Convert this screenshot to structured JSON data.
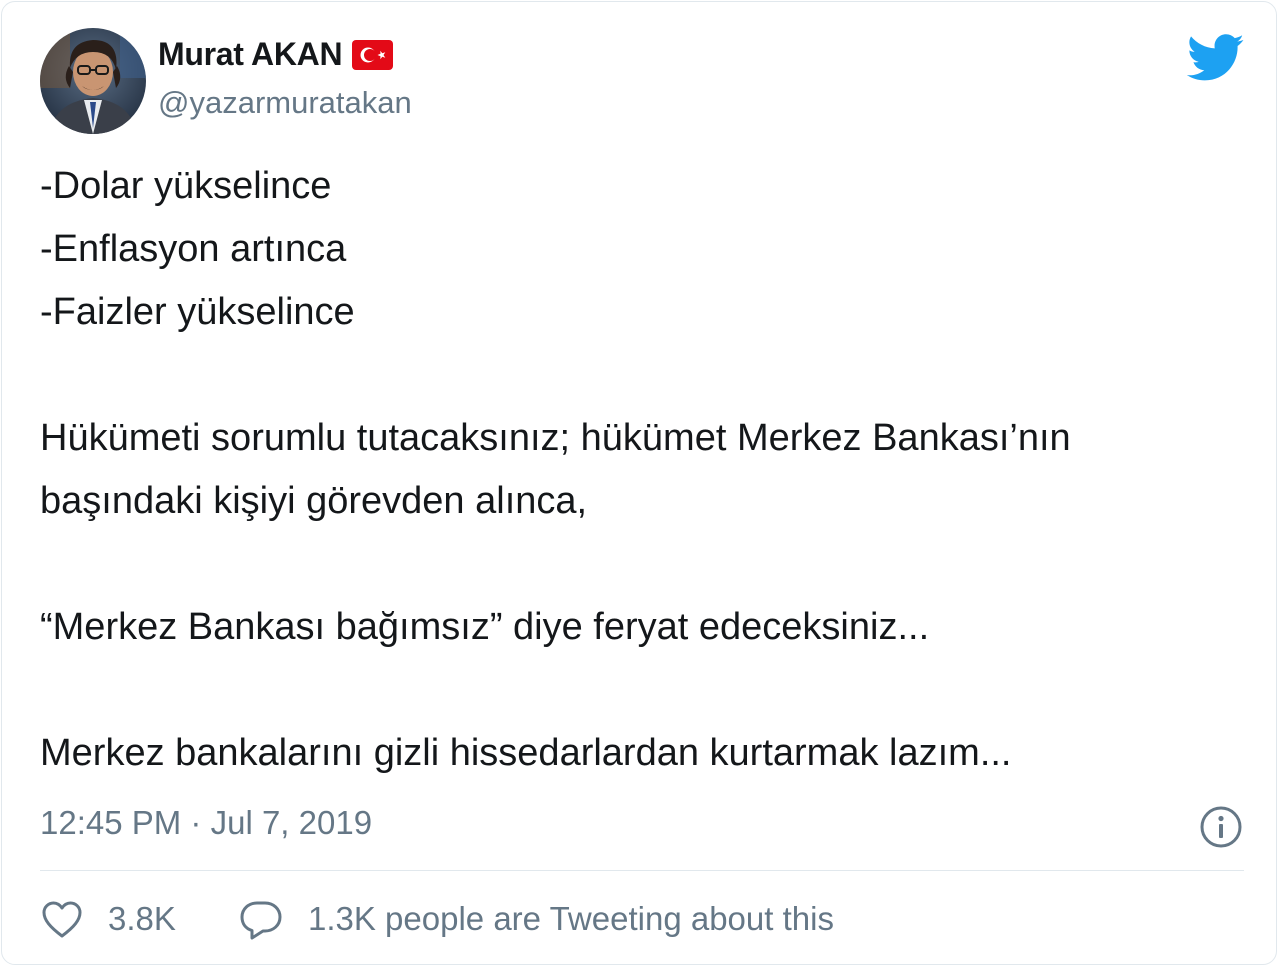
{
  "author": {
    "name": "Murat AKAN",
    "handle": "@yazarmuratakan",
    "flag_icon": "turkey-flag-icon",
    "avatar_icon": "profile-photo"
  },
  "brand": {
    "icon": "twitter-bird-icon",
    "color": "#1da1f2"
  },
  "tweet": {
    "lines": [
      "-Dolar yükselince",
      "-Enflasyon artınca",
      "-Faizler yükselince",
      "",
      "Hükümeti sorumlu tutacaksınız; hükümet Merkez Bankası’nın",
      "başındaki kişiyi görevden alınca,",
      "",
      "“Merkez Bankası bağımsız” diye feryat edeceksiniz...",
      "",
      "Merkez bankalarını gizli hissedarlardan kurtarmak lazım..."
    ]
  },
  "meta": {
    "time": "12:45 PM",
    "separator": "·",
    "date": "Jul 7, 2019",
    "info_icon": "info-icon"
  },
  "actions": {
    "likes": "3.8K",
    "conversation": "1.3K people are Tweeting about this",
    "like_icon": "heart-icon",
    "reply_icon": "speech-bubble-icon"
  },
  "colors": {
    "text": "#14171a",
    "secondary": "#657786",
    "border": "#e1e8ed",
    "flag_red": "#e30a17"
  }
}
